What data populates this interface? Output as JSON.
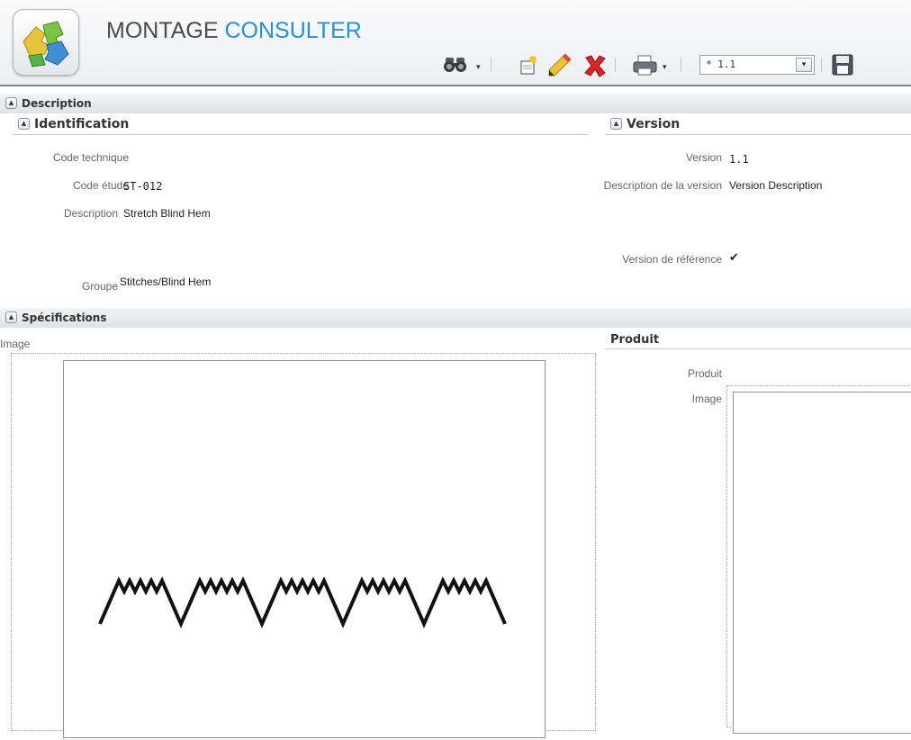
{
  "header": {
    "title_part1": "MONTAGE",
    "title_part2": "CONSULTER"
  },
  "toolbar": {
    "buttons": [
      "binoculars-icon",
      "new-document-icon",
      "pencil-icon",
      "delete-icon",
      "printer-icon",
      "save-icon"
    ],
    "version_select_value": "* 1.1",
    "dropdown_glyph": "▾",
    "accent_color": "#2a8fd0",
    "delete_color": "#d8262b"
  },
  "description_section": {
    "title": "Description",
    "identification": {
      "title": "Identification",
      "fields": {
        "code_technique_label": "Code technique",
        "code_technique_value": "",
        "code_etude_label": "Code étude",
        "code_etude_value": "ST-012",
        "description_label": "Description",
        "description_value": "Stretch Blind Hem",
        "groupe_label": "Groupe",
        "groupe_value": "Stitches/Blind Hem"
      }
    },
    "version": {
      "title": "Version",
      "version_label": "Version",
      "version_value": "1.1",
      "description_label": "Description de la version",
      "description_value": "Version Description",
      "reference_label": "Version de référence",
      "reference_value": "✔"
    }
  },
  "specifications_section": {
    "title": "Spécifications",
    "image_label": "Image",
    "produit": {
      "title": "Produit",
      "produit_label": "Produit",
      "produit_value": "",
      "image_label": "Image"
    }
  },
  "collapse_glyph": "▲"
}
